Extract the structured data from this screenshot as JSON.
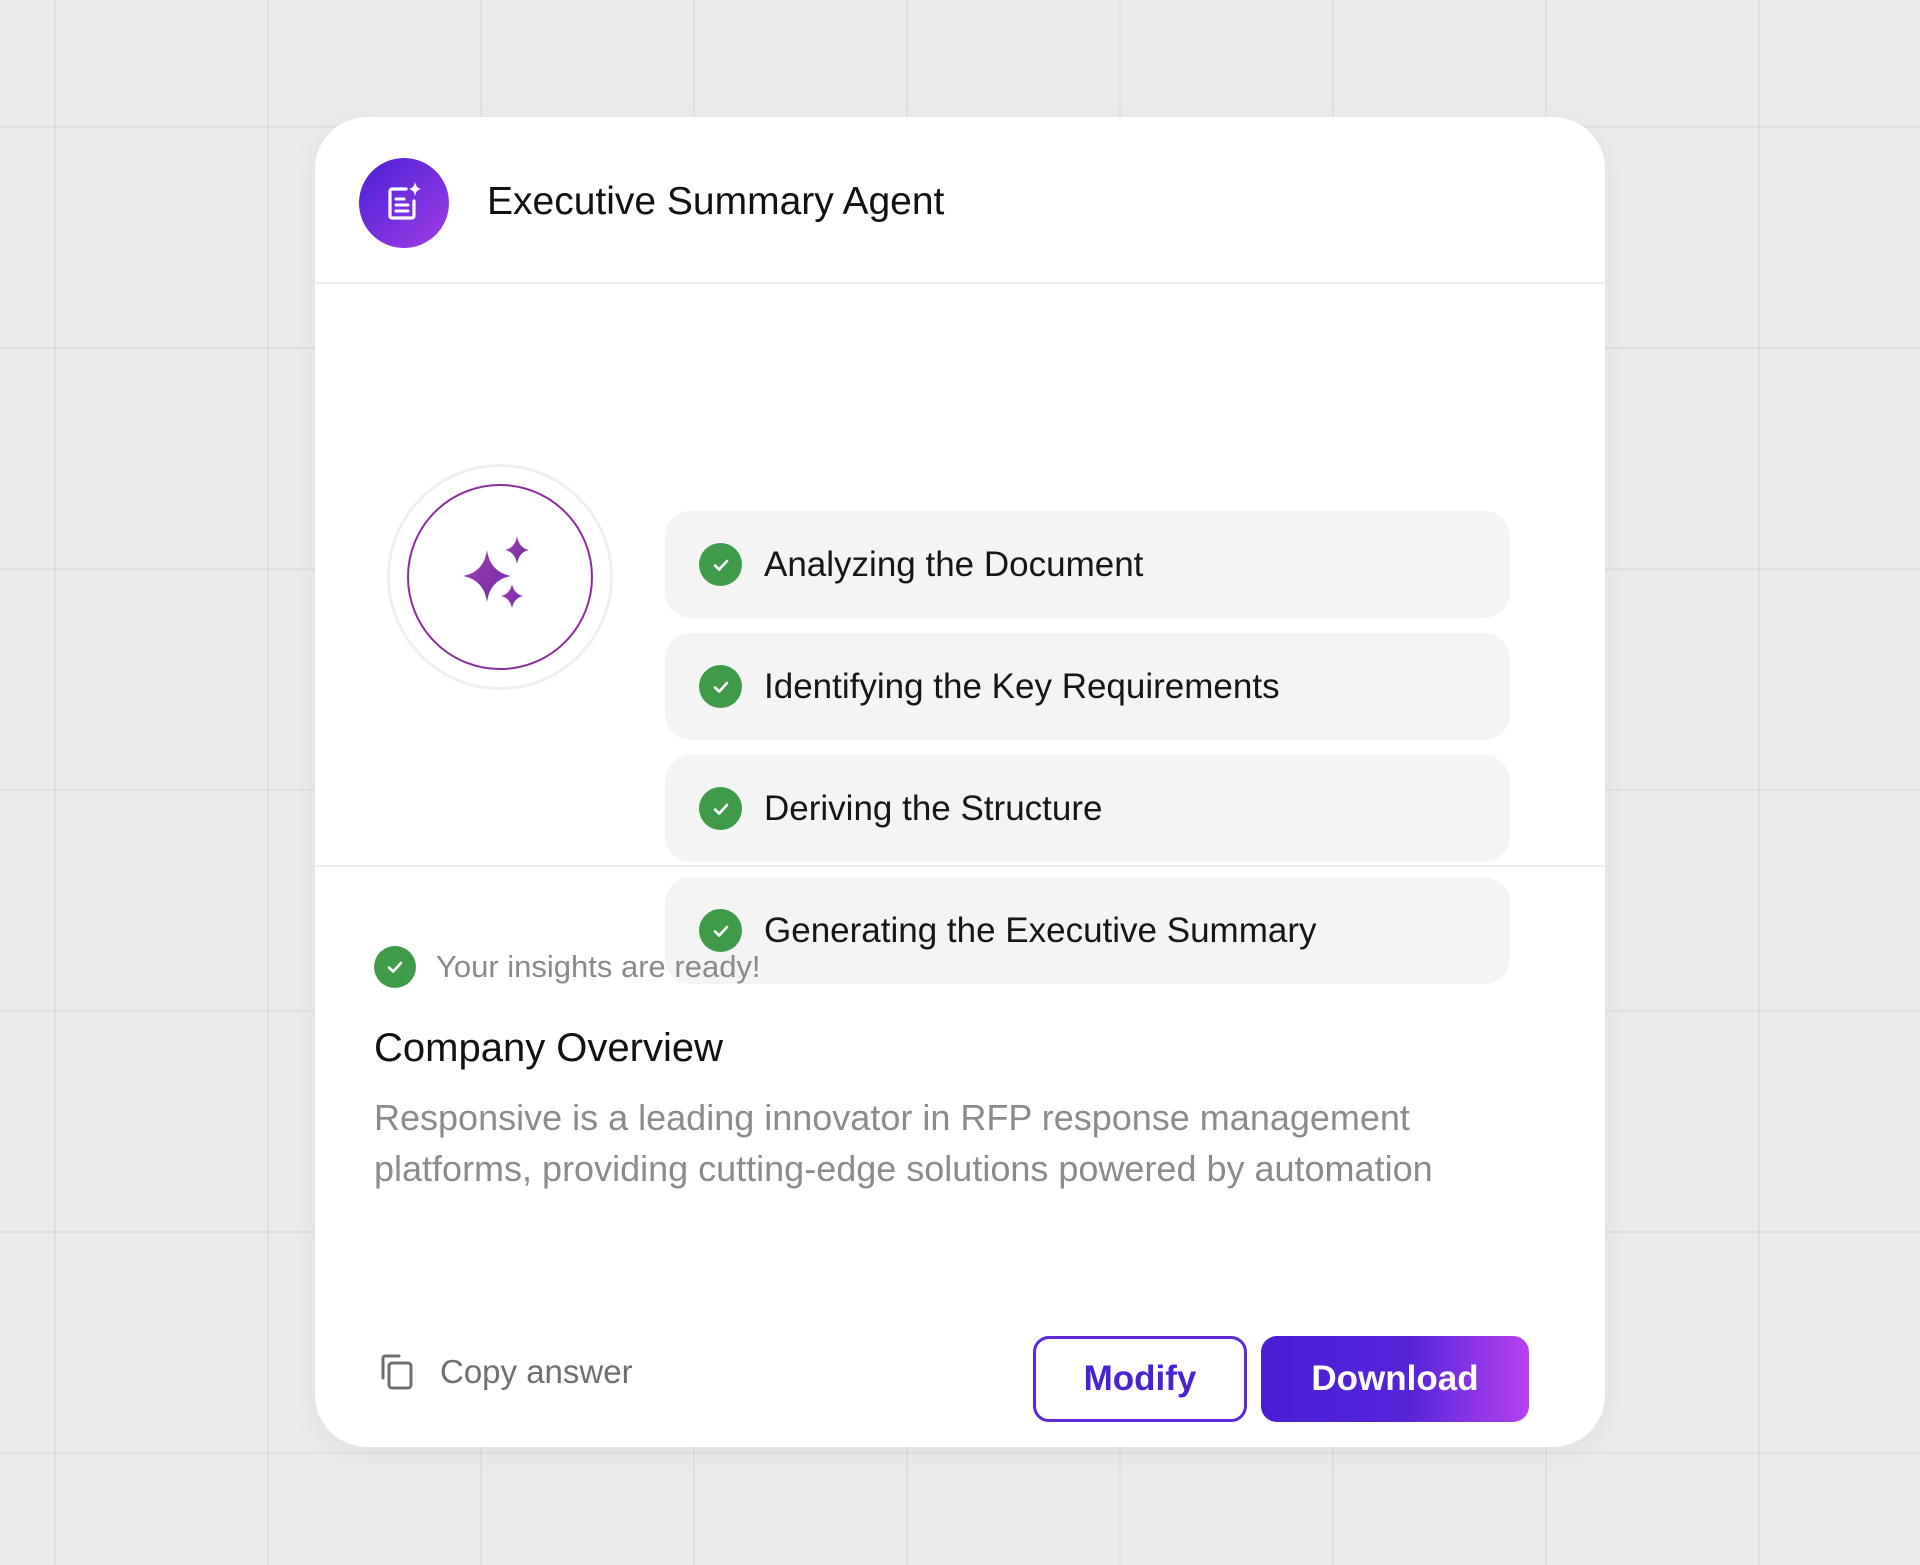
{
  "theme": {
    "accent": "#4a22d3",
    "accent_gradient_end": "#b742f0",
    "success": "#3f9b48"
  },
  "header": {
    "icon": "document-sparkle-icon",
    "title": "Executive Summary Agent"
  },
  "process": {
    "icon": "sparkles-icon",
    "steps": [
      {
        "label": "Analyzing the Document",
        "status": "complete"
      },
      {
        "label": "Identifying the Key Requirements",
        "status": "complete"
      },
      {
        "label": "Deriving the Structure",
        "status": "complete"
      },
      {
        "label": "Generating the Executive Summary",
        "status": "complete"
      }
    ]
  },
  "result": {
    "status_text": "Your insights are ready!",
    "title": "Company Overview",
    "body": "Responsive is a leading innovator in RFP response management platforms, providing cutting-edge solutions powered by automation"
  },
  "actions": {
    "copy_icon": "copy-icon",
    "copy_label": "Copy answer",
    "modify_label": "Modify",
    "download_label": "Download"
  }
}
